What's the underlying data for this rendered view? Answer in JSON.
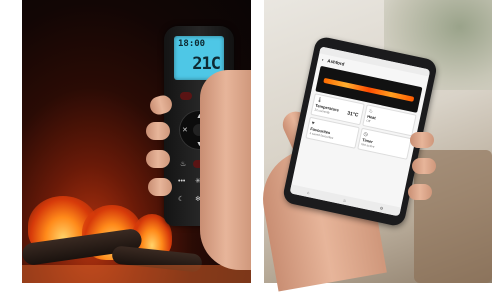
{
  "remote": {
    "lcd_time": "18:00",
    "lcd_temp": "21C"
  },
  "phone": {
    "header_title": "Ashford",
    "back_glyph": "‹",
    "tiles": [
      {
        "label": "Temperature",
        "sub": "21 currently",
        "value": "31°C",
        "icon": "thermometer-icon"
      },
      {
        "label": "Heat",
        "sub": "Off",
        "value": "",
        "icon": "heat-icon"
      },
      {
        "label": "Favourites",
        "sub": "4 saved favourites",
        "value": "",
        "icon": "heart-icon"
      },
      {
        "label": "Timer",
        "sub": "Not active",
        "value": "",
        "icon": "clock-icon"
      }
    ]
  },
  "colors": {
    "lcd": "#4ec7e6",
    "fire": "#ff8a1a"
  }
}
